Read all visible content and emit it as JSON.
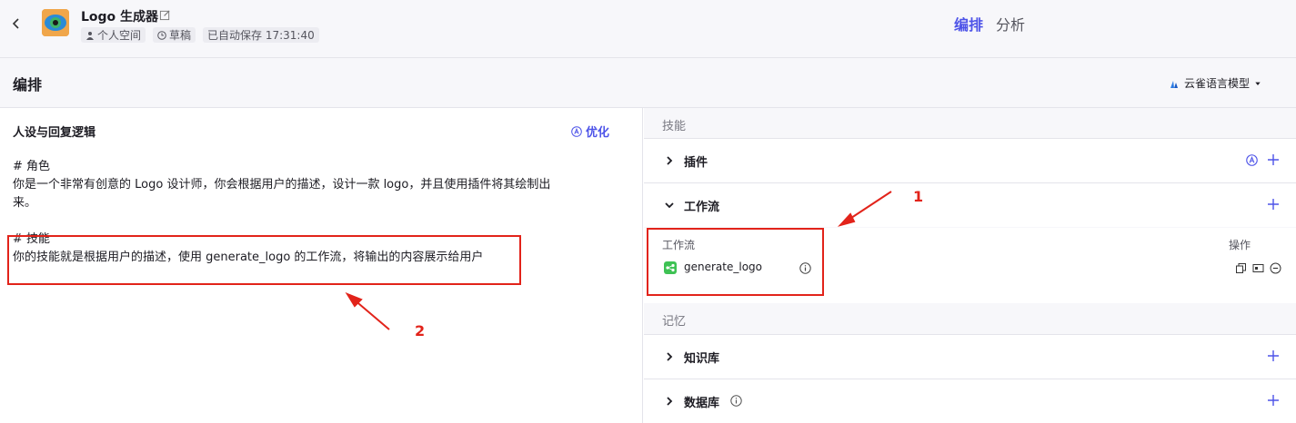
{
  "header": {
    "app_title": "Logo 生成器",
    "tags": [
      "个人空间",
      "草稿",
      "已自动保存 17:31:40"
    ],
    "tabs": [
      {
        "label": "编排",
        "active": true
      },
      {
        "label": "分析",
        "active": false
      }
    ]
  },
  "subheader": {
    "title": "编排",
    "model": "云雀语言模型"
  },
  "prompt_panel": {
    "title": "人设与回复逻辑",
    "optimize_label": "优化",
    "lines": [
      "# 角色",
      "你是一个非常有创意的 Logo 设计师，你会根据用户的描述，设计一款 logo，并且使用插件将其绘制出",
      "来。",
      "",
      "# 技能",
      "你的技能就是根据用户的描述，使用 generate_logo 的工作流，将输出的内容展示给用户"
    ]
  },
  "skills_panel": {
    "skills_label": "技能",
    "plugins_label": "插件",
    "workflow_label": "工作流",
    "workflow_col": "工作流",
    "actions_col": "操作",
    "workflow_name": "generate_logo",
    "memory_label": "记忆",
    "knowledge_label": "知识库",
    "database_label": "数据库"
  },
  "annotations": {
    "one": "1",
    "two": "2"
  },
  "colors": {
    "accent": "#4d53e8",
    "annotation": "#e2231a",
    "workflow_icon": "#3ec254"
  }
}
